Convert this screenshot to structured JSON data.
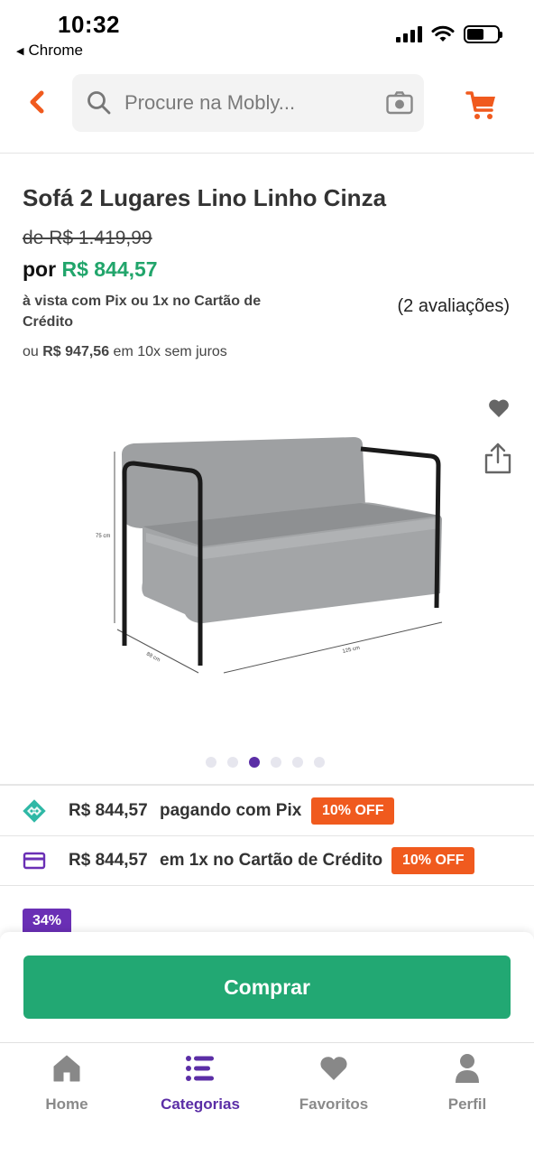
{
  "status_bar": {
    "time": "10:32",
    "back_app": "Chrome",
    "icons": [
      "signal-icon",
      "wifi-icon",
      "battery-icon"
    ]
  },
  "header": {
    "back_icon": "chevron-left-icon",
    "search_placeholder": "Procure na Mobly...",
    "search_icon": "search-icon",
    "camera_icon": "camera-icon",
    "cart_icon": "cart-icon"
  },
  "product": {
    "title": "Sofá 2 Lugares Lino Linho Cinza",
    "old_price": "de R$ 1.419,99",
    "price_prefix": "por ",
    "price": "R$ 844,57",
    "payment_note": "à vista com Pix ou 1x no Cartão de Crédito",
    "reviews": "(2 avaliações)",
    "installments_prefix": "ou ",
    "installments_value": "R$ 947,56",
    "installments_suffix": " em 10x sem juros",
    "image_labels": {
      "height": "75 cm",
      "depth": "88 cm",
      "width": "125 cm"
    },
    "carousel": {
      "total": 6,
      "active_index": 2
    }
  },
  "offers": [
    {
      "icon": "pix-icon",
      "amount": "R$ 844,57",
      "description": "pagando com Pix",
      "badge": "10% OFF"
    },
    {
      "icon": "credit-card-icon",
      "amount": "R$ 844,57",
      "description": "em 1x no Cartão de Crédito",
      "badge": "10% OFF"
    }
  ],
  "discount_badge": "34%",
  "buy_button": "Comprar",
  "bottom_nav": [
    {
      "label": "Home",
      "icon": "home-icon",
      "active": false
    },
    {
      "label": "Categorias",
      "icon": "categories-icon",
      "active": true
    },
    {
      "label": "Favoritos",
      "icon": "heart-icon",
      "active": false
    },
    {
      "label": "Perfil",
      "icon": "user-icon",
      "active": false
    }
  ],
  "colors": {
    "accent_orange": "#f05a1e",
    "price_green": "#21a56b",
    "buy_green": "#22a873",
    "purple": "#5b2ea6"
  }
}
